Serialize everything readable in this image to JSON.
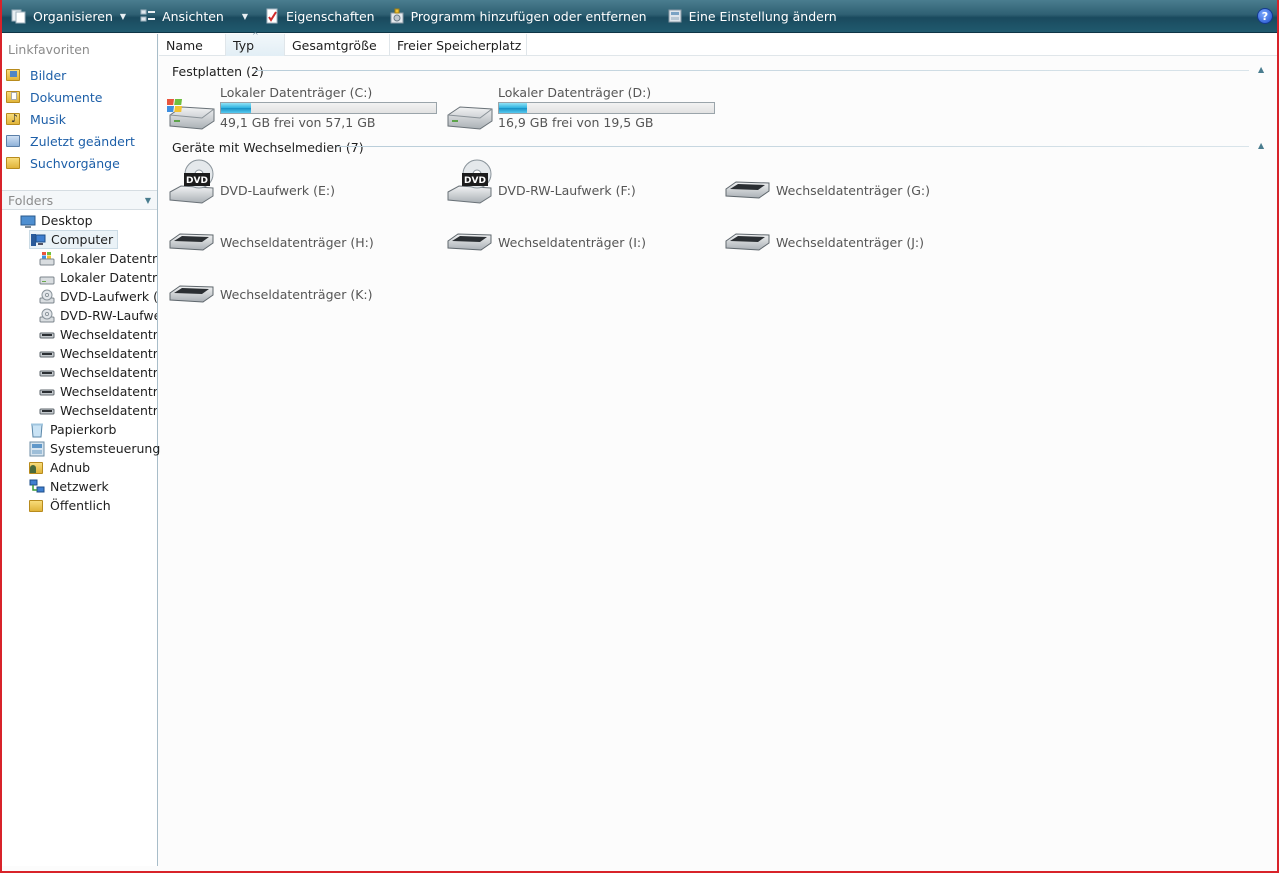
{
  "toolbar": {
    "organize": "Organisieren",
    "views": "Ansichten",
    "properties": "Eigenschaften",
    "add_remove": "Programm hinzufügen oder entfernen",
    "change_setting": "Eine Einstellung ändern",
    "help": "?"
  },
  "nav": {
    "favorites_title": "Linkfavoriten",
    "favorites": [
      {
        "label": "Bilder",
        "icon": "pictures-icon"
      },
      {
        "label": "Dokumente",
        "icon": "documents-icon"
      },
      {
        "label": "Musik",
        "icon": "music-icon"
      },
      {
        "label": "Zuletzt geändert",
        "icon": "recent-icon"
      },
      {
        "label": "Suchvorgänge",
        "icon": "searches-icon"
      }
    ],
    "folders_title": "Folders",
    "tree": [
      {
        "label": "Desktop",
        "icon": "desktop-icon"
      },
      {
        "label": "Computer",
        "icon": "computer-icon"
      },
      {
        "label": "Lokaler Datenträg",
        "icon": "windows-drive-icon"
      },
      {
        "label": "Lokaler Datenträg",
        "icon": "hard-drive-icon"
      },
      {
        "label": "DVD-Laufwerk (E:)",
        "icon": "dvd-drive-icon"
      },
      {
        "label": "DVD-RW-Laufwer",
        "icon": "dvd-drive-icon"
      },
      {
        "label": "Wechseldatenträg",
        "icon": "removable-drive-icon"
      },
      {
        "label": "Wechseldatenträg",
        "icon": "removable-drive-icon"
      },
      {
        "label": "Wechseldatenträg",
        "icon": "removable-drive-icon"
      },
      {
        "label": "Wechseldatenträg",
        "icon": "removable-drive-icon"
      },
      {
        "label": "Wechseldatenträg",
        "icon": "removable-drive-icon"
      },
      {
        "label": "Papierkorb",
        "icon": "recycle-bin-icon"
      },
      {
        "label": "Systemsteuerung",
        "icon": "control-panel-icon"
      },
      {
        "label": "Adnub",
        "icon": "user-folder-icon"
      },
      {
        "label": "Netzwerk",
        "icon": "network-icon"
      },
      {
        "label": "Öffentlich",
        "icon": "public-folder-icon"
      }
    ]
  },
  "columns": [
    "Name",
    "Typ",
    "Gesamtgröße",
    "Freier Speicherplatz"
  ],
  "groups": {
    "hard_disks": {
      "title": "Festplatten (2)",
      "drives": [
        {
          "name": "Lokaler Datenträger (C:)",
          "free_text": "49,1 GB frei von 57,1 GB",
          "used_fraction": 0.14,
          "icon": "windows-drive-icon"
        },
        {
          "name": "Lokaler Datenträger (D:)",
          "free_text": "16,9 GB frei von 19,5 GB",
          "used_fraction": 0.13,
          "icon": "hard-drive-icon"
        }
      ]
    },
    "removable": {
      "title": "Geräte mit Wechselmedien (7)",
      "drives": [
        {
          "name": "DVD-Laufwerk (E:)",
          "icon": "dvd-drive-icon",
          "badge": "DVD"
        },
        {
          "name": "DVD-RW-Laufwerk (F:)",
          "icon": "dvd-drive-icon",
          "badge": "DVD"
        },
        {
          "name": "Wechseldatenträger (G:)",
          "icon": "removable-drive-icon"
        },
        {
          "name": "Wechseldatenträger (H:)",
          "icon": "removable-drive-icon"
        },
        {
          "name": "Wechseldatenträger (I:)",
          "icon": "removable-drive-icon"
        },
        {
          "name": "Wechseldatenträger (J:)",
          "icon": "removable-drive-icon"
        },
        {
          "name": "Wechseldatenträger (K:)",
          "icon": "removable-drive-icon"
        }
      ]
    }
  },
  "colors": {
    "toolbar": "#2f6073",
    "link": "#1d5fa8",
    "frame": "#d8232a",
    "bar_fill": "#2cb2e0"
  }
}
